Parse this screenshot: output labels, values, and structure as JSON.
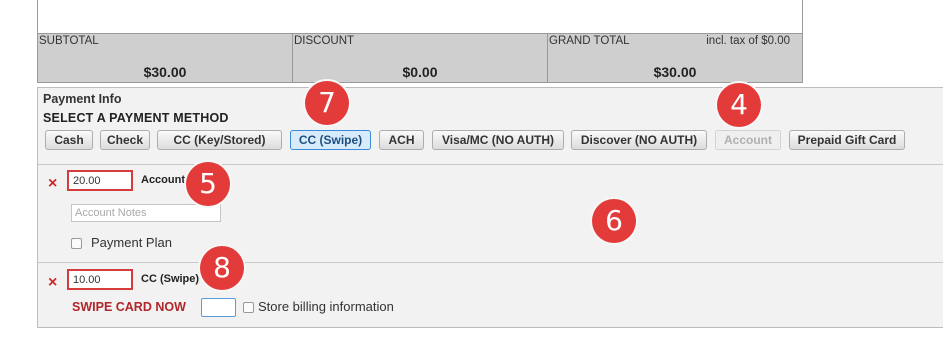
{
  "totals": {
    "subtotal_label": "SUBTOTAL",
    "subtotal_value": "$30.00",
    "discount_label": "DISCOUNT",
    "discount_value": "$0.00",
    "grand_total_label": "GRAND TOTAL",
    "tax_note": "incl. tax of $0.00",
    "grand_total_value": "$30.00"
  },
  "payment": {
    "section_title": "Payment Info",
    "select_title": "SELECT A PAYMENT METHOD",
    "methods": [
      {
        "label": "Cash",
        "state": "normal"
      },
      {
        "label": "Check",
        "state": "normal"
      },
      {
        "label": "CC (Key/Stored)",
        "state": "normal"
      },
      {
        "label": "CC (Swipe)",
        "state": "active"
      },
      {
        "label": "ACH",
        "state": "normal"
      },
      {
        "label": "Visa/MC (NO AUTH)",
        "state": "normal"
      },
      {
        "label": "Discover (NO AUTH)",
        "state": "normal"
      },
      {
        "label": "Account",
        "state": "disabled"
      },
      {
        "label": "Prepaid Gift Card",
        "state": "normal"
      }
    ],
    "entries": [
      {
        "remove_icon": "×",
        "amount": "20.00",
        "method_label": "Account",
        "notes_placeholder": "Account Notes",
        "payment_plan_label": "Payment Plan"
      },
      {
        "remove_icon": "×",
        "amount": "10.00",
        "method_label": "CC (Swipe)",
        "swipe_prompt": "SWIPE CARD NOW",
        "store_billing_label": "Store billing information"
      }
    ]
  },
  "callouts": [
    "7",
    "4",
    "5",
    "6",
    "8"
  ],
  "colors": {
    "callout": "#e23b39",
    "active_button": "#d8ebfb",
    "amount_border": "#d63c3c",
    "swipe_prompt": "#b0262a"
  }
}
